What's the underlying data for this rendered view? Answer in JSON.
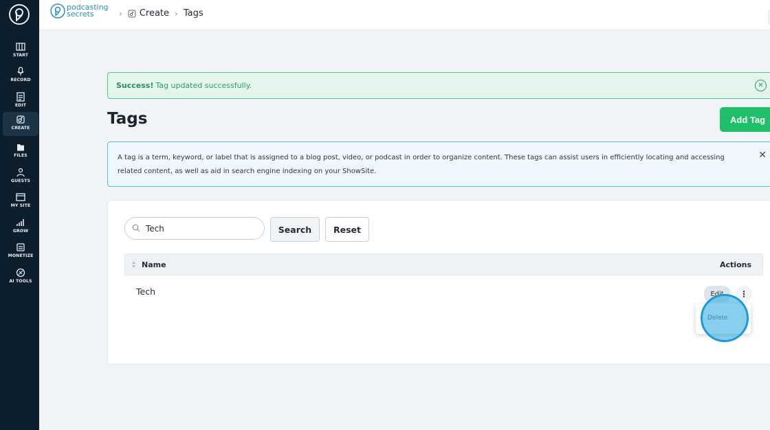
{
  "sidebar": {
    "items": [
      {
        "label": "START",
        "icon": "piano-icon"
      },
      {
        "label": "RECORD",
        "icon": "microphone-icon"
      },
      {
        "label": "EDIT",
        "icon": "edit-sliders-icon"
      },
      {
        "label": "CREATE",
        "icon": "create-icon",
        "active": true
      },
      {
        "label": "FILES",
        "icon": "files-icon"
      },
      {
        "label": "GUESTS",
        "icon": "guests-icon"
      },
      {
        "label": "MY SITE",
        "icon": "browser-icon"
      },
      {
        "label": "GROW",
        "icon": "bar-chart-icon"
      },
      {
        "label": "MONETIZE",
        "icon": "monetize-icon"
      },
      {
        "label": "AI TOOLS",
        "icon": "ai-tools-icon"
      }
    ]
  },
  "header": {
    "brand_line1": "podcasting",
    "brand_line2": "secrets",
    "breadcrumb": [
      "Create",
      "Tags"
    ]
  },
  "alert": {
    "strong": "Success!",
    "message": "Tag updated successfully."
  },
  "page": {
    "title": "Tags",
    "add_button": "Add Tag",
    "info_text": "A tag is a term, keyword, or label that is assigned to a blog post, video, or podcast in order to organize content. These tags can assist users in efficiently locating and accessing related content, as well as aid in search engine indexing on your ShowSite."
  },
  "search": {
    "value": "Tech",
    "search_label": "Search",
    "reset_label": "Reset"
  },
  "table": {
    "columns": [
      "Name",
      "Actions"
    ],
    "rows": [
      {
        "name": "Tech",
        "edit_label": "Edit"
      }
    ]
  },
  "dropdown": {
    "items": [
      "Delete"
    ]
  },
  "colors": {
    "sidebar_bg": "#0c1d2b",
    "accent_green": "#20c06a",
    "success_text": "#2f9c6e",
    "brand_blue": "#2a8fb3"
  }
}
